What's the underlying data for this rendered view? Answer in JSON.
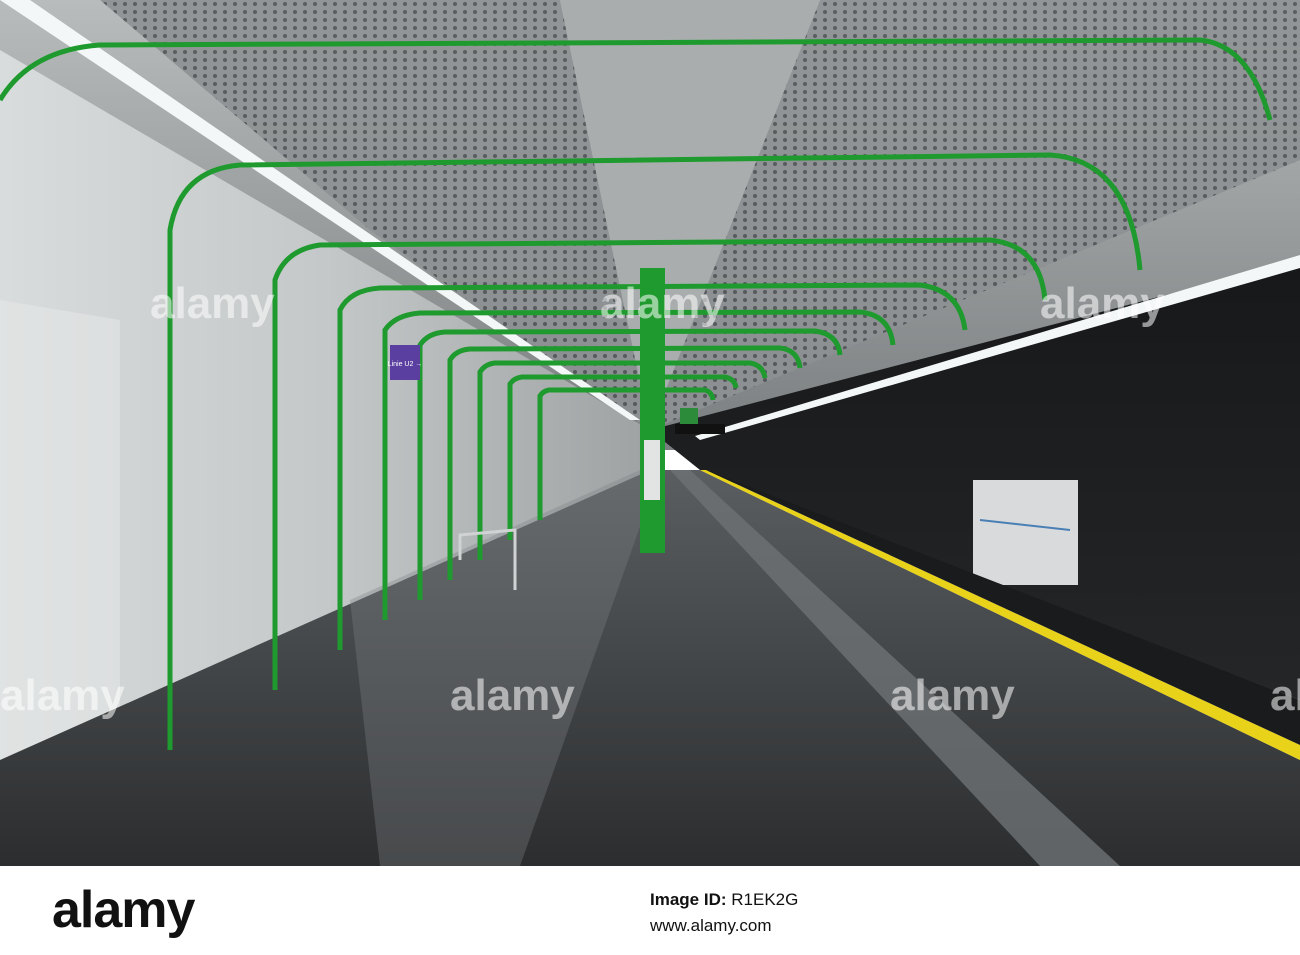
{
  "photo": {
    "subject": "",
    "platform_sign": "Linie U2 →",
    "watermark": "alamy"
  },
  "footer": {
    "logo": "alamy",
    "image_id_label": "Image ID:",
    "image_id": "R1EK2G",
    "url": "www.alamy.com"
  },
  "colors": {
    "frame_green": "#1f9a2e",
    "track_line_yellow": "#e8d21a",
    "sign_purple": "#5a3fa0"
  }
}
